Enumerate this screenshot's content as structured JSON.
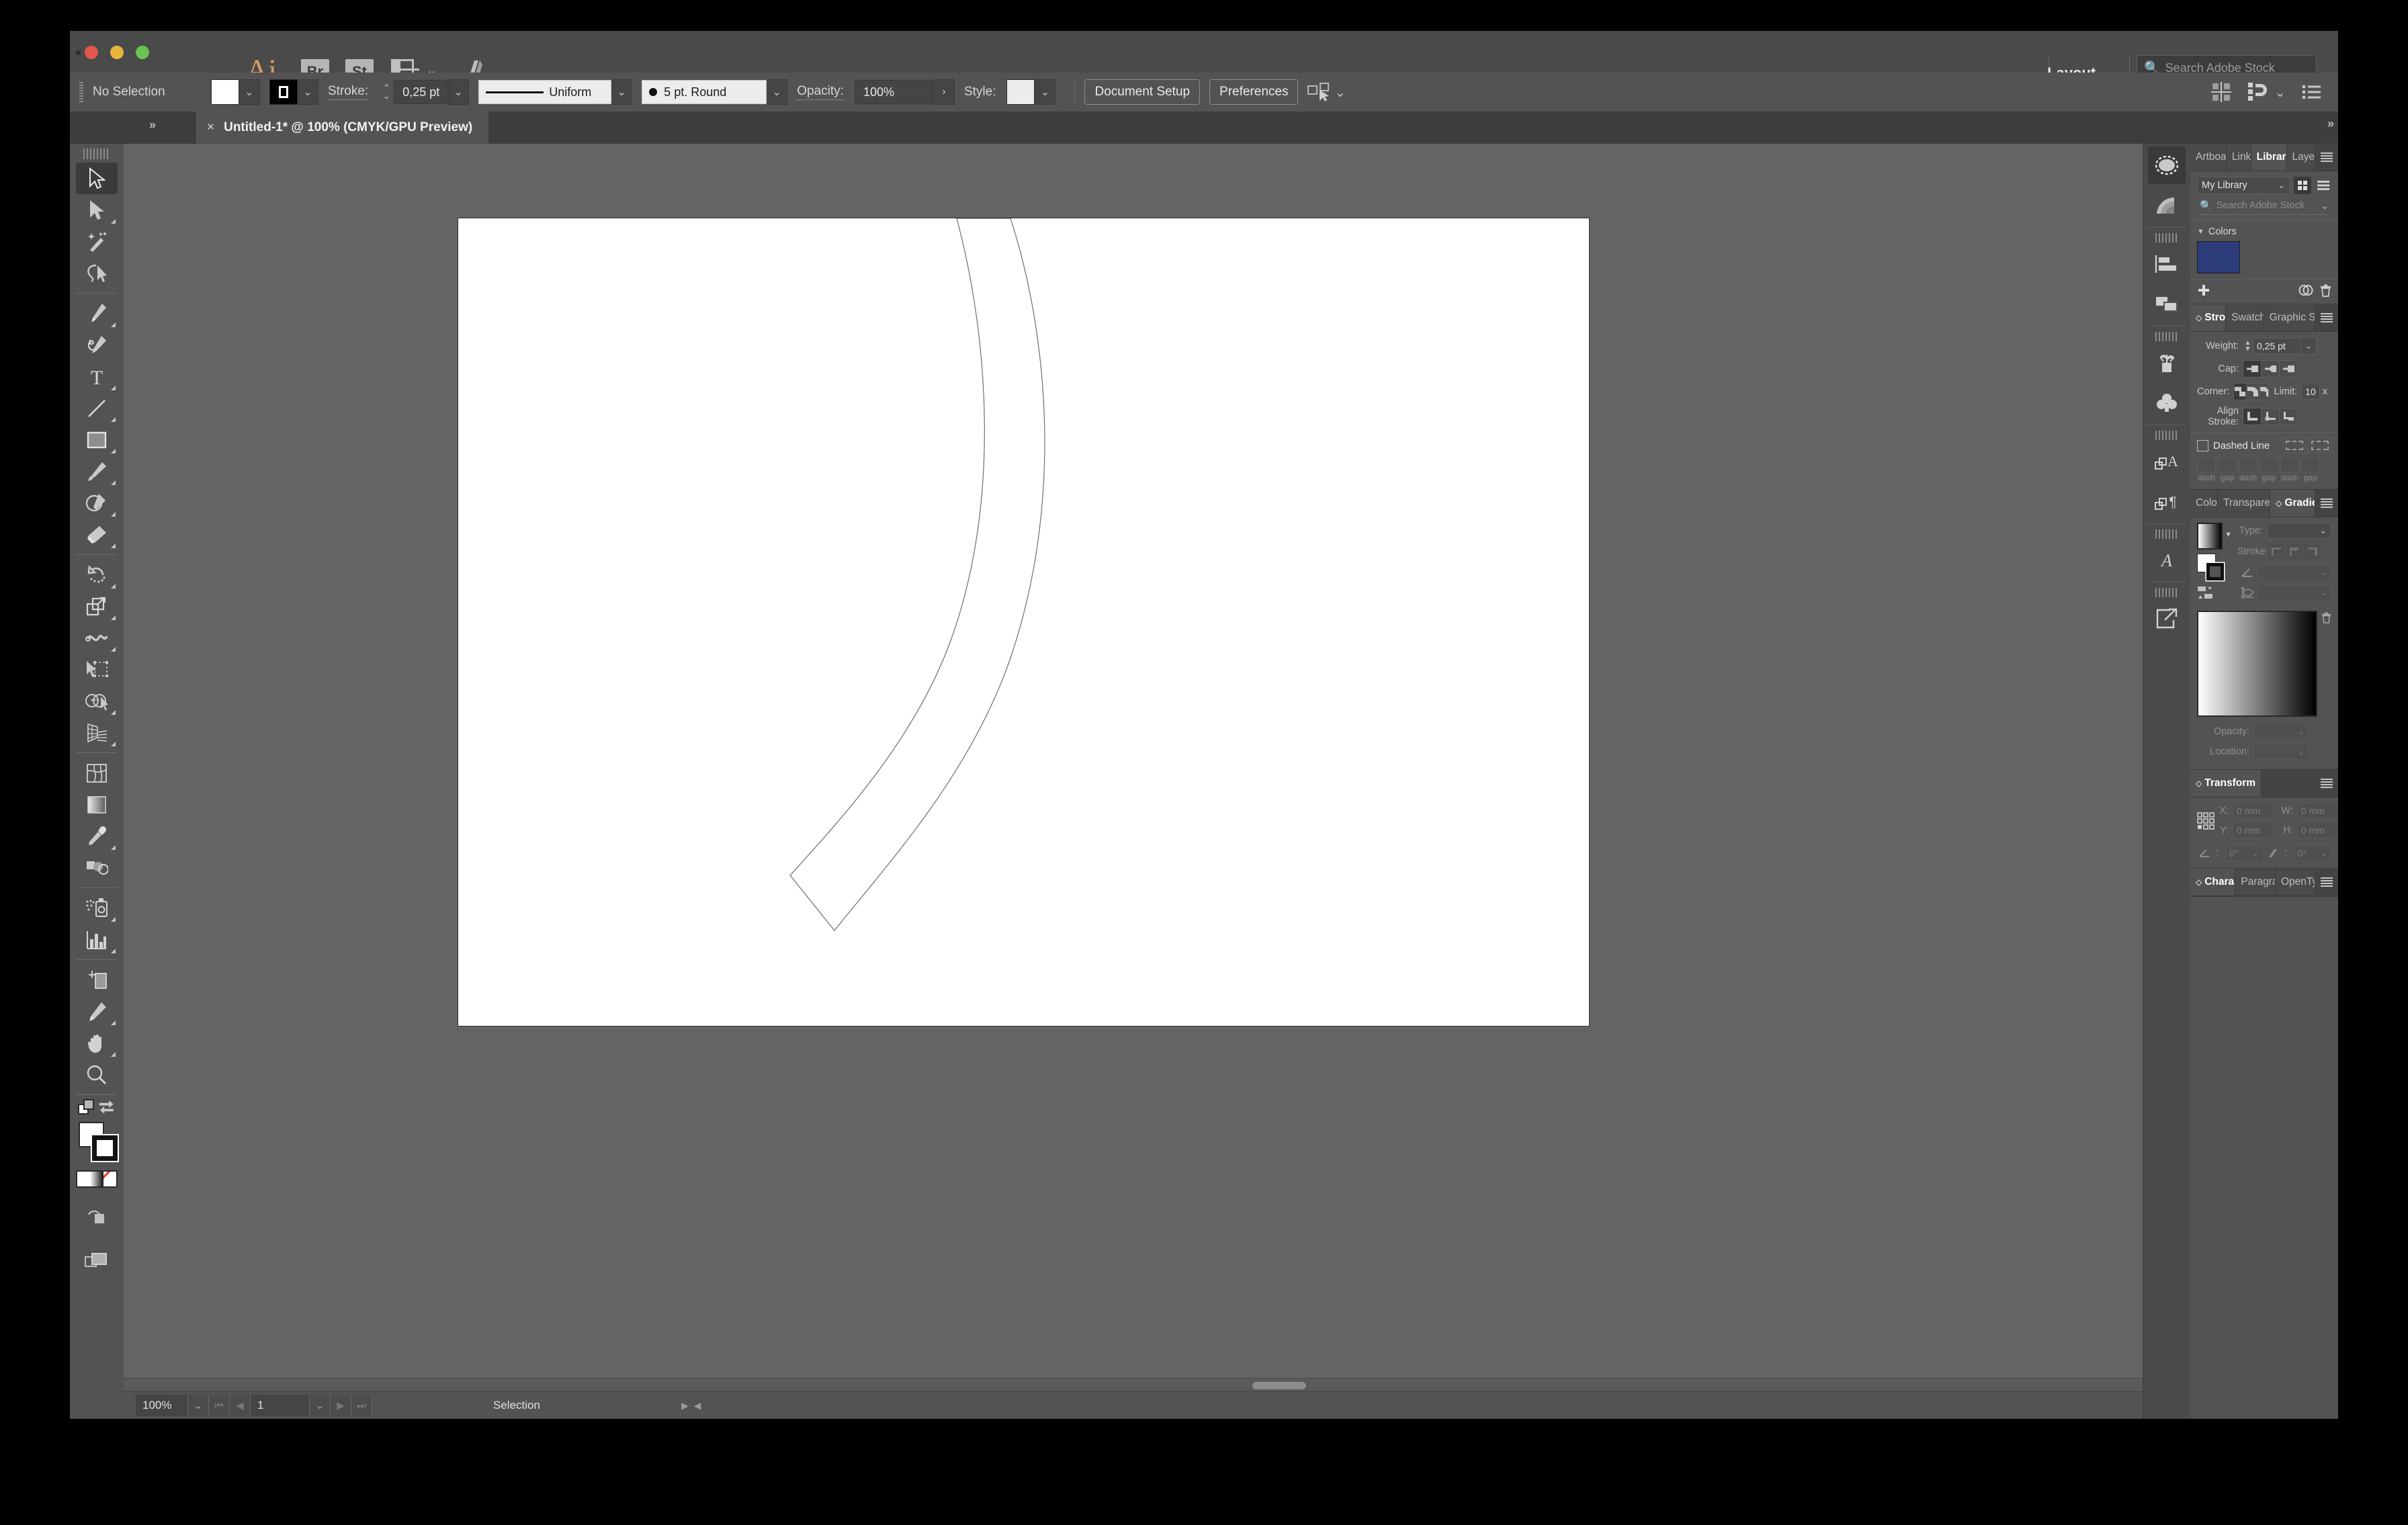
{
  "window": {
    "app_name": "Ai",
    "app_buttons": [
      "Br",
      "St"
    ],
    "arrange_icon": "arrange-documents-icon",
    "stock_icon": "adobe-stock-icon",
    "workspace": "Layout",
    "stock_search_placeholder": "Search Adobe Stock"
  },
  "control_bar": {
    "selection_status": "No Selection",
    "fill_swatch_color": "#ffffff",
    "stroke_swatch_color": "#000000",
    "stroke_label": "Stroke:",
    "stroke_weight": "0,25 pt",
    "profile": "Uniform",
    "brush": "5 pt. Round",
    "opacity_label": "Opacity:",
    "opacity_value": "100%",
    "style_label": "Style:",
    "style_swatch_color": "#ececec",
    "document_setup": "Document Setup",
    "preferences": "Preferences",
    "select_similar_icon": "select-similar-objects-icon",
    "align_icon": "align-icon",
    "snap_icon": "snap-to-glyph-icon",
    "options_icon": "panel-options-icon"
  },
  "tab_bar": {
    "close_icon": "close-tab-icon",
    "document_title": "Untitled-1* @ 100% (CMYK/GPU Preview)",
    "left_expand_icon": "expand-panel-icon",
    "right_expand_icon": "expand-panel-icon"
  },
  "toolbar": {
    "tools": [
      {
        "name": "selection-tool",
        "active": true,
        "corner": false
      },
      {
        "name": "direct-selection-tool",
        "active": false,
        "corner": true
      },
      {
        "name": "magic-wand-tool",
        "active": false,
        "corner": false
      },
      {
        "name": "lasso-tool",
        "active": false,
        "corner": false
      },
      {
        "name": "pen-tool",
        "active": false,
        "corner": true
      },
      {
        "name": "curvature-tool",
        "active": false,
        "corner": false
      },
      {
        "name": "type-tool",
        "active": false,
        "corner": true
      },
      {
        "name": "line-segment-tool",
        "active": false,
        "corner": true
      },
      {
        "name": "rectangle-tool",
        "active": false,
        "corner": true
      },
      {
        "name": "paintbrush-tool",
        "active": false,
        "corner": true
      },
      {
        "name": "shaper-tool",
        "active": false,
        "corner": true
      },
      {
        "name": "eraser-tool",
        "active": false,
        "corner": true
      },
      {
        "name": "rotate-tool",
        "active": false,
        "corner": true
      },
      {
        "name": "scale-tool",
        "active": false,
        "corner": true
      },
      {
        "name": "width-tool",
        "active": false,
        "corner": true
      },
      {
        "name": "free-transform-tool",
        "active": false,
        "corner": false
      },
      {
        "name": "shape-builder-tool",
        "active": false,
        "corner": true
      },
      {
        "name": "perspective-grid-tool",
        "active": false,
        "corner": true
      },
      {
        "name": "mesh-tool",
        "active": false,
        "corner": false
      },
      {
        "name": "gradient-tool",
        "active": false,
        "corner": false
      },
      {
        "name": "eyedropper-tool",
        "active": false,
        "corner": true
      },
      {
        "name": "blend-tool",
        "active": false,
        "corner": false
      },
      {
        "name": "symbol-sprayer-tool",
        "active": false,
        "corner": true
      },
      {
        "name": "column-graph-tool",
        "active": false,
        "corner": true
      },
      {
        "name": "artboard-tool",
        "active": false,
        "corner": false
      },
      {
        "name": "slice-tool",
        "active": false,
        "corner": true
      },
      {
        "name": "hand-tool",
        "active": false,
        "corner": true
      },
      {
        "name": "zoom-tool",
        "active": false,
        "corner": false
      }
    ],
    "fill_color": "#ffffff",
    "stroke_color": "#ffffff",
    "swap_icon": "swap-fill-stroke-icon",
    "default_icon": "default-fill-stroke-icon",
    "color_modes": [
      "color-swatch",
      "gradient-swatch",
      "none-swatch"
    ],
    "drawing_mode_icon": "draw-normal-icon",
    "screen_mode_icon": "change-screen-mode-icon"
  },
  "canvas": {
    "background_color": "#646464",
    "artboard_color": "#ffffff",
    "shape_name": "curved-arc-path",
    "shape_stroke": "#6a6a6a"
  },
  "status_bar": {
    "zoom": "100%",
    "artboard_number": "1",
    "status_text": "Selection",
    "first_icon": "first-artboard-icon",
    "prev_icon": "previous-artboard-icon",
    "next_icon": "next-artboard-icon",
    "last_icon": "last-artboard-icon"
  },
  "dock_rail": {
    "items": [
      {
        "name": "appearance-icon",
        "active": true
      },
      {
        "name": "gradient-rail-icon",
        "active": false
      },
      {
        "name": "align-rail-icon",
        "active": false
      },
      {
        "name": "pathfinder-rail-icon",
        "active": false
      },
      {
        "name": "brushes-rail-icon",
        "active": false
      },
      {
        "name": "symbols-rail-icon",
        "active": false
      },
      {
        "name": "character-styles-rail-icon",
        "active": false
      },
      {
        "name": "paragraph-styles-rail-icon",
        "active": false
      },
      {
        "name": "glyphs-rail-icon",
        "active": false
      },
      {
        "name": "asset-export-rail-icon",
        "active": false
      }
    ]
  },
  "libraries_panel": {
    "tabs": [
      {
        "label": "Artboards",
        "active": false
      },
      {
        "label": "Links",
        "active": false
      },
      {
        "label": "Libraries",
        "active": true
      },
      {
        "label": "Layers",
        "active": false
      }
    ],
    "library_select": "My Library",
    "grid_view_icon": "grid-view-icon",
    "list_view_icon": "list-view-icon",
    "search_icon": "search-icon",
    "search_placeholder": "Search Adobe Stock",
    "search_filter_icon": "chevron-down-icon",
    "section_label": "Colors",
    "color_swatches": [
      "#2c3b79"
    ],
    "add_icon": "add-content-icon",
    "cc_icon": "creative-cloud-icon",
    "delete_icon": "trash-icon"
  },
  "stroke_panel": {
    "tabs": [
      {
        "label": "Stroke",
        "active": true
      },
      {
        "label": "Swatches",
        "active": false
      },
      {
        "label": "Graphic Styles",
        "active": false
      }
    ],
    "weight_label": "Weight:",
    "weight_value": "0,25 pt",
    "cap_label": "Cap:",
    "cap_options": [
      "butt-cap-icon",
      "round-cap-icon",
      "projecting-cap-icon"
    ],
    "cap_selected": 0,
    "corner_label": "Corner:",
    "corner_options": [
      "miter-join-icon",
      "round-join-icon",
      "bevel-join-icon"
    ],
    "corner_selected": 0,
    "limit_label": "Limit:",
    "limit_value": "10",
    "limit_unit": "x",
    "align_label": "Align Stroke:",
    "align_options": [
      "align-center-stroke-icon",
      "align-inside-stroke-icon",
      "align-outside-stroke-icon"
    ],
    "align_selected": 0,
    "dashed_line_label": "Dashed Line",
    "dashed_checked": false,
    "dash_corner_icons": [
      "dash-preserve-exact-icon",
      "dash-adjust-corners-icon"
    ],
    "dash_labels": [
      "dash",
      "gap",
      "dash",
      "gap",
      "dash",
      "gap"
    ]
  },
  "gradient_panel": {
    "tabs": [
      {
        "label": "Color",
        "active": false
      },
      {
        "label": "Transparency",
        "active": false
      },
      {
        "label": "Gradient",
        "active": true
      }
    ],
    "type_label": "Type:",
    "type_value": "",
    "stroke_label": "Stroke:",
    "stroke_options": [
      "gradient-within-stroke-icon",
      "gradient-along-stroke-icon",
      "gradient-across-stroke-icon"
    ],
    "angle_label": "gradient-angle-icon",
    "angle_value": "",
    "aspect_label": "gradient-aspect-ratio-icon",
    "aspect_value": "",
    "gradient_start": "#ffffff",
    "gradient_end": "#000000",
    "fill_color": "#ffffff",
    "opacity_label": "Opacity:",
    "opacity_value": "",
    "location_label": "Location:",
    "location_value": "",
    "delete_stop_icon": "trash-icon",
    "reverse_icon": "reverse-gradient-icon"
  },
  "transform_panel": {
    "tabs": [
      {
        "label": "Transform",
        "active": true
      }
    ],
    "reference_point_icon": "reference-point-grid-icon",
    "x_label": "X:",
    "x_value": "0 mm",
    "y_label": "Y:",
    "y_value": "0 mm",
    "w_label": "W:",
    "w_value": "0 mm",
    "h_label": "H:",
    "h_value": "0 mm",
    "link_icon": "constrain-proportions-unlinked-icon",
    "rotate_label": "rotate-angle-icon",
    "rotate_value": "0°",
    "shear_label": "shear-angle-icon",
    "shear_value": "0°"
  },
  "character_panel": {
    "tabs": [
      {
        "label": "Character",
        "active": true
      },
      {
        "label": "Paragraph",
        "active": false
      },
      {
        "label": "OpenType",
        "active": false
      }
    ]
  }
}
